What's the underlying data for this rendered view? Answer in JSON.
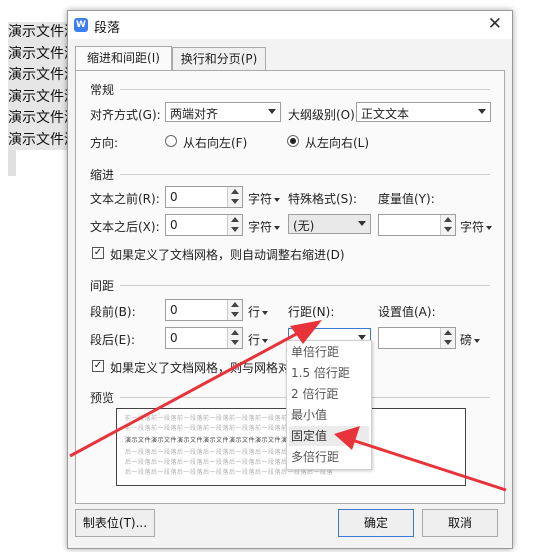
{
  "document": {
    "lines": [
      "演示文件演示文件",
      "演示文件演示文件",
      "演示文件演示文件",
      "演示文件演示文件",
      "演示文件演示文件",
      "演示文件演示文件"
    ]
  },
  "dialog": {
    "title": "段落",
    "icon_letter": "W",
    "close_glyph": "✕",
    "tabs": [
      {
        "label": "缩进和间距(I)",
        "active": true
      },
      {
        "label": "换行和分页(P)",
        "active": false
      }
    ],
    "general": {
      "heading": "常规",
      "alignment_label": "对齐方式(G):",
      "alignment_value": "两端对齐",
      "outline_label": "大纲级别(O):",
      "outline_value": "正文文本",
      "direction_label": "方向:",
      "direction_rtl": "从右向左(F)",
      "direction_ltr": "从左向右(L)",
      "direction_selected": "ltr"
    },
    "indent": {
      "heading": "缩进",
      "before_label": "文本之前(R):",
      "before_value": "0",
      "before_unit": "字符",
      "after_label": "文本之后(X):",
      "after_value": "0",
      "after_unit": "字符",
      "special_label": "特殊格式(S):",
      "special_value": "(无)",
      "measure_label": "度量值(Y):",
      "measure_value": "",
      "measure_unit": "字符",
      "auto_adjust_label": "如果定义了文档网格，则自动调整右缩进(D)",
      "auto_adjust_checked": true
    },
    "spacing": {
      "heading": "间距",
      "before_label": "段前(B):",
      "before_value": "0",
      "before_unit": "行",
      "after_label": "段后(E):",
      "after_value": "0",
      "after_unit": "行",
      "line_label": "行距(N):",
      "line_value": "",
      "set_label": "设置值(A):",
      "set_value": "",
      "set_unit": "磅",
      "grid_label": "如果定义了文档网格，则与网格对齐",
      "grid_checked": true
    },
    "line_spacing_options": [
      "单倍行距",
      "1.5 倍行距",
      "2 倍行距",
      "最小值",
      "固定值",
      "多倍行距"
    ],
    "line_spacing_highlight": "固定值",
    "preview": {
      "heading": "预览",
      "prev_text": "前一段落前一段落前一段落前一段落前一段落前一段落前一段落前一段落",
      "sample_text": "演示文件演示文件演示文件演示文件演示文件演示文件演示文件",
      "next_text": "后一段落后一段落后一段落后一段落后一段落后一段落后一段落后一段落"
    },
    "buttons": {
      "tabs_label": "制表位(T)...",
      "ok_label": "确定",
      "cancel_label": "取消"
    }
  },
  "colors": {
    "accent": "#3b78d8",
    "arrow": "#e8333a"
  }
}
